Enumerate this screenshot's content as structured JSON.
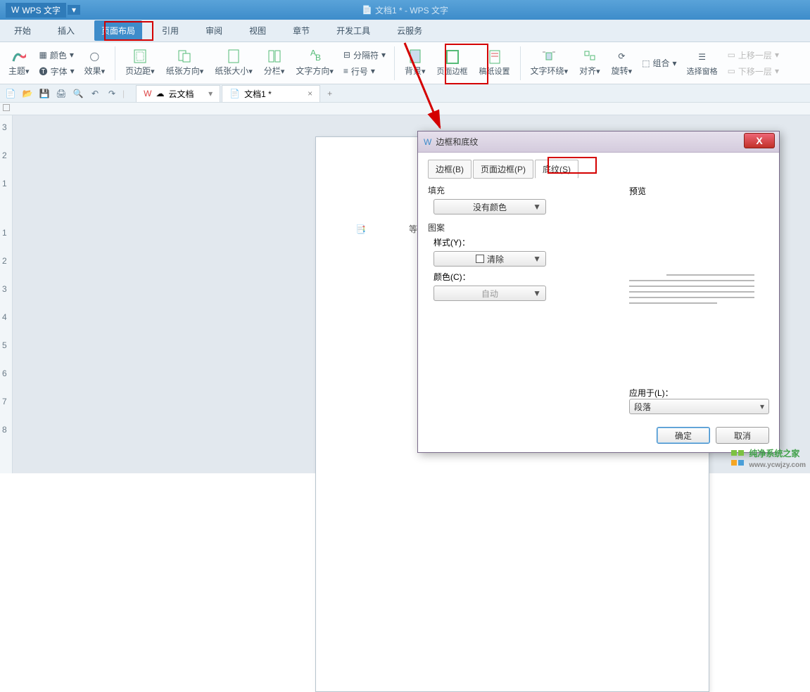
{
  "app": {
    "name": "WPS 文字",
    "doc_title": "文档1 * - WPS 文字"
  },
  "menu": {
    "items": [
      "开始",
      "插入",
      "页面布局",
      "引用",
      "审阅",
      "视图",
      "章节",
      "开发工具",
      "云服务"
    ],
    "active": 2
  },
  "ribbon": {
    "theme": "主题",
    "font": "字体",
    "effects": "效果",
    "color": "颜色",
    "margins": "页边距",
    "orientation": "纸张方向",
    "size": "纸张大小",
    "columns": "分栏",
    "text_dir": "文字方向",
    "line_num": "行号",
    "breaks": "分隔符",
    "background": "背景",
    "page_border": "页面边框",
    "paper_setup": "稿纸设置",
    "wrap": "文字环绕",
    "align": "对齐",
    "rotate": "旋转",
    "select_pane": "选择窗格",
    "group": "组合",
    "bring_fwd": "上移一层",
    "send_back": "下移一层"
  },
  "qat": {
    "cloud_tab": "云文档",
    "doc_tab": "文档1 *"
  },
  "page": {
    "placeholder": "等等"
  },
  "dialog": {
    "title": "边框和底纹",
    "tabs": {
      "border": "边框(B)",
      "page_border": "页面边框(P)",
      "shading": "底纹(S)"
    },
    "fill": "填充",
    "no_color": "没有颜色",
    "pattern": "图案",
    "style": "样式(Y)：",
    "clear": "清除",
    "color": "颜色(C)：",
    "auto": "自动",
    "preview": "预览",
    "apply_to": "应用于(L)：",
    "paragraph": "段落",
    "ok": "确定",
    "cancel": "取消"
  },
  "watermark": {
    "line1": "纯净系统之家",
    "line2": "www.ycwjzy.com"
  }
}
